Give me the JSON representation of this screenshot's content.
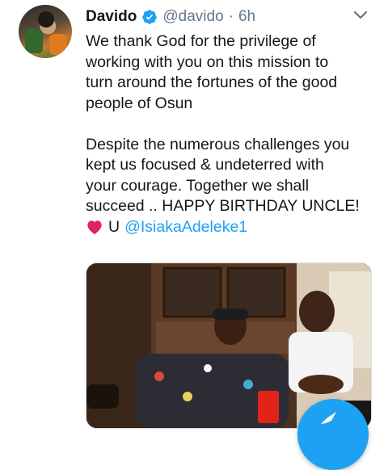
{
  "tweet": {
    "display_name": "Davido",
    "handle": "@davido",
    "separator": "·",
    "time": "6h",
    "paragraph1": "We thank God for the privilege of\nworking with you on this mission to\nturn around the fortunes of the good\npeople of Osun",
    "paragraph2": "Despite the numerous challenges you\nkept us focused & undeterred with\nyour courage. Together we shall\nsucceed .. HAPPY BIRTHDAY UNCLE!",
    "mention_prefix": "U",
    "mention": "@IsiakaAdeleke1"
  },
  "colors": {
    "accent": "#1da1f2",
    "heart": "#e0245e",
    "muted": "#657786",
    "text": "#14171a"
  },
  "icons": {
    "verified": "verified-badge-icon",
    "menu": "chevron-down-icon",
    "heart": "red-heart-emoji-icon",
    "compose": "compose-tweet-icon"
  }
}
